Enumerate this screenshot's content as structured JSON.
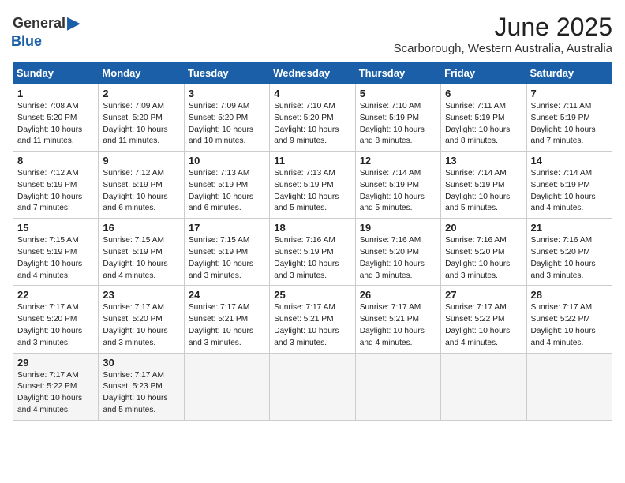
{
  "logo": {
    "general": "General",
    "blue": "Blue",
    "arrow": "▶"
  },
  "title": "June 2025",
  "location": "Scarborough, Western Australia, Australia",
  "weekdays": [
    "Sunday",
    "Monday",
    "Tuesday",
    "Wednesday",
    "Thursday",
    "Friday",
    "Saturday"
  ],
  "weeks": [
    [
      {
        "day": 1,
        "sunrise": "7:08 AM",
        "sunset": "5:20 PM",
        "daylight": "10 hours and 11 minutes."
      },
      {
        "day": 2,
        "sunrise": "7:09 AM",
        "sunset": "5:20 PM",
        "daylight": "10 hours and 11 minutes."
      },
      {
        "day": 3,
        "sunrise": "7:09 AM",
        "sunset": "5:20 PM",
        "daylight": "10 hours and 10 minutes."
      },
      {
        "day": 4,
        "sunrise": "7:10 AM",
        "sunset": "5:20 PM",
        "daylight": "10 hours and 9 minutes."
      },
      {
        "day": 5,
        "sunrise": "7:10 AM",
        "sunset": "5:19 PM",
        "daylight": "10 hours and 8 minutes."
      },
      {
        "day": 6,
        "sunrise": "7:11 AM",
        "sunset": "5:19 PM",
        "daylight": "10 hours and 8 minutes."
      },
      {
        "day": 7,
        "sunrise": "7:11 AM",
        "sunset": "5:19 PM",
        "daylight": "10 hours and 7 minutes."
      }
    ],
    [
      {
        "day": 8,
        "sunrise": "7:12 AM",
        "sunset": "5:19 PM",
        "daylight": "10 hours and 7 minutes."
      },
      {
        "day": 9,
        "sunrise": "7:12 AM",
        "sunset": "5:19 PM",
        "daylight": "10 hours and 6 minutes."
      },
      {
        "day": 10,
        "sunrise": "7:13 AM",
        "sunset": "5:19 PM",
        "daylight": "10 hours and 6 minutes."
      },
      {
        "day": 11,
        "sunrise": "7:13 AM",
        "sunset": "5:19 PM",
        "daylight": "10 hours and 5 minutes."
      },
      {
        "day": 12,
        "sunrise": "7:14 AM",
        "sunset": "5:19 PM",
        "daylight": "10 hours and 5 minutes."
      },
      {
        "day": 13,
        "sunrise": "7:14 AM",
        "sunset": "5:19 PM",
        "daylight": "10 hours and 5 minutes."
      },
      {
        "day": 14,
        "sunrise": "7:14 AM",
        "sunset": "5:19 PM",
        "daylight": "10 hours and 4 minutes."
      }
    ],
    [
      {
        "day": 15,
        "sunrise": "7:15 AM",
        "sunset": "5:19 PM",
        "daylight": "10 hours and 4 minutes."
      },
      {
        "day": 16,
        "sunrise": "7:15 AM",
        "sunset": "5:19 PM",
        "daylight": "10 hours and 4 minutes."
      },
      {
        "day": 17,
        "sunrise": "7:15 AM",
        "sunset": "5:19 PM",
        "daylight": "10 hours and 3 minutes."
      },
      {
        "day": 18,
        "sunrise": "7:16 AM",
        "sunset": "5:19 PM",
        "daylight": "10 hours and 3 minutes."
      },
      {
        "day": 19,
        "sunrise": "7:16 AM",
        "sunset": "5:20 PM",
        "daylight": "10 hours and 3 minutes."
      },
      {
        "day": 20,
        "sunrise": "7:16 AM",
        "sunset": "5:20 PM",
        "daylight": "10 hours and 3 minutes."
      },
      {
        "day": 21,
        "sunrise": "7:16 AM",
        "sunset": "5:20 PM",
        "daylight": "10 hours and 3 minutes."
      }
    ],
    [
      {
        "day": 22,
        "sunrise": "7:17 AM",
        "sunset": "5:20 PM",
        "daylight": "10 hours and 3 minutes."
      },
      {
        "day": 23,
        "sunrise": "7:17 AM",
        "sunset": "5:20 PM",
        "daylight": "10 hours and 3 minutes."
      },
      {
        "day": 24,
        "sunrise": "7:17 AM",
        "sunset": "5:21 PM",
        "daylight": "10 hours and 3 minutes."
      },
      {
        "day": 25,
        "sunrise": "7:17 AM",
        "sunset": "5:21 PM",
        "daylight": "10 hours and 3 minutes."
      },
      {
        "day": 26,
        "sunrise": "7:17 AM",
        "sunset": "5:21 PM",
        "daylight": "10 hours and 4 minutes."
      },
      {
        "day": 27,
        "sunrise": "7:17 AM",
        "sunset": "5:22 PM",
        "daylight": "10 hours and 4 minutes."
      },
      {
        "day": 28,
        "sunrise": "7:17 AM",
        "sunset": "5:22 PM",
        "daylight": "10 hours and 4 minutes."
      }
    ],
    [
      {
        "day": 29,
        "sunrise": "7:17 AM",
        "sunset": "5:22 PM",
        "daylight": "10 hours and 4 minutes."
      },
      {
        "day": 30,
        "sunrise": "7:17 AM",
        "sunset": "5:23 PM",
        "daylight": "10 hours and 5 minutes."
      },
      null,
      null,
      null,
      null,
      null
    ]
  ],
  "labels": {
    "sunrise": "Sunrise:",
    "sunset": "Sunset:",
    "daylight": "Daylight:"
  }
}
